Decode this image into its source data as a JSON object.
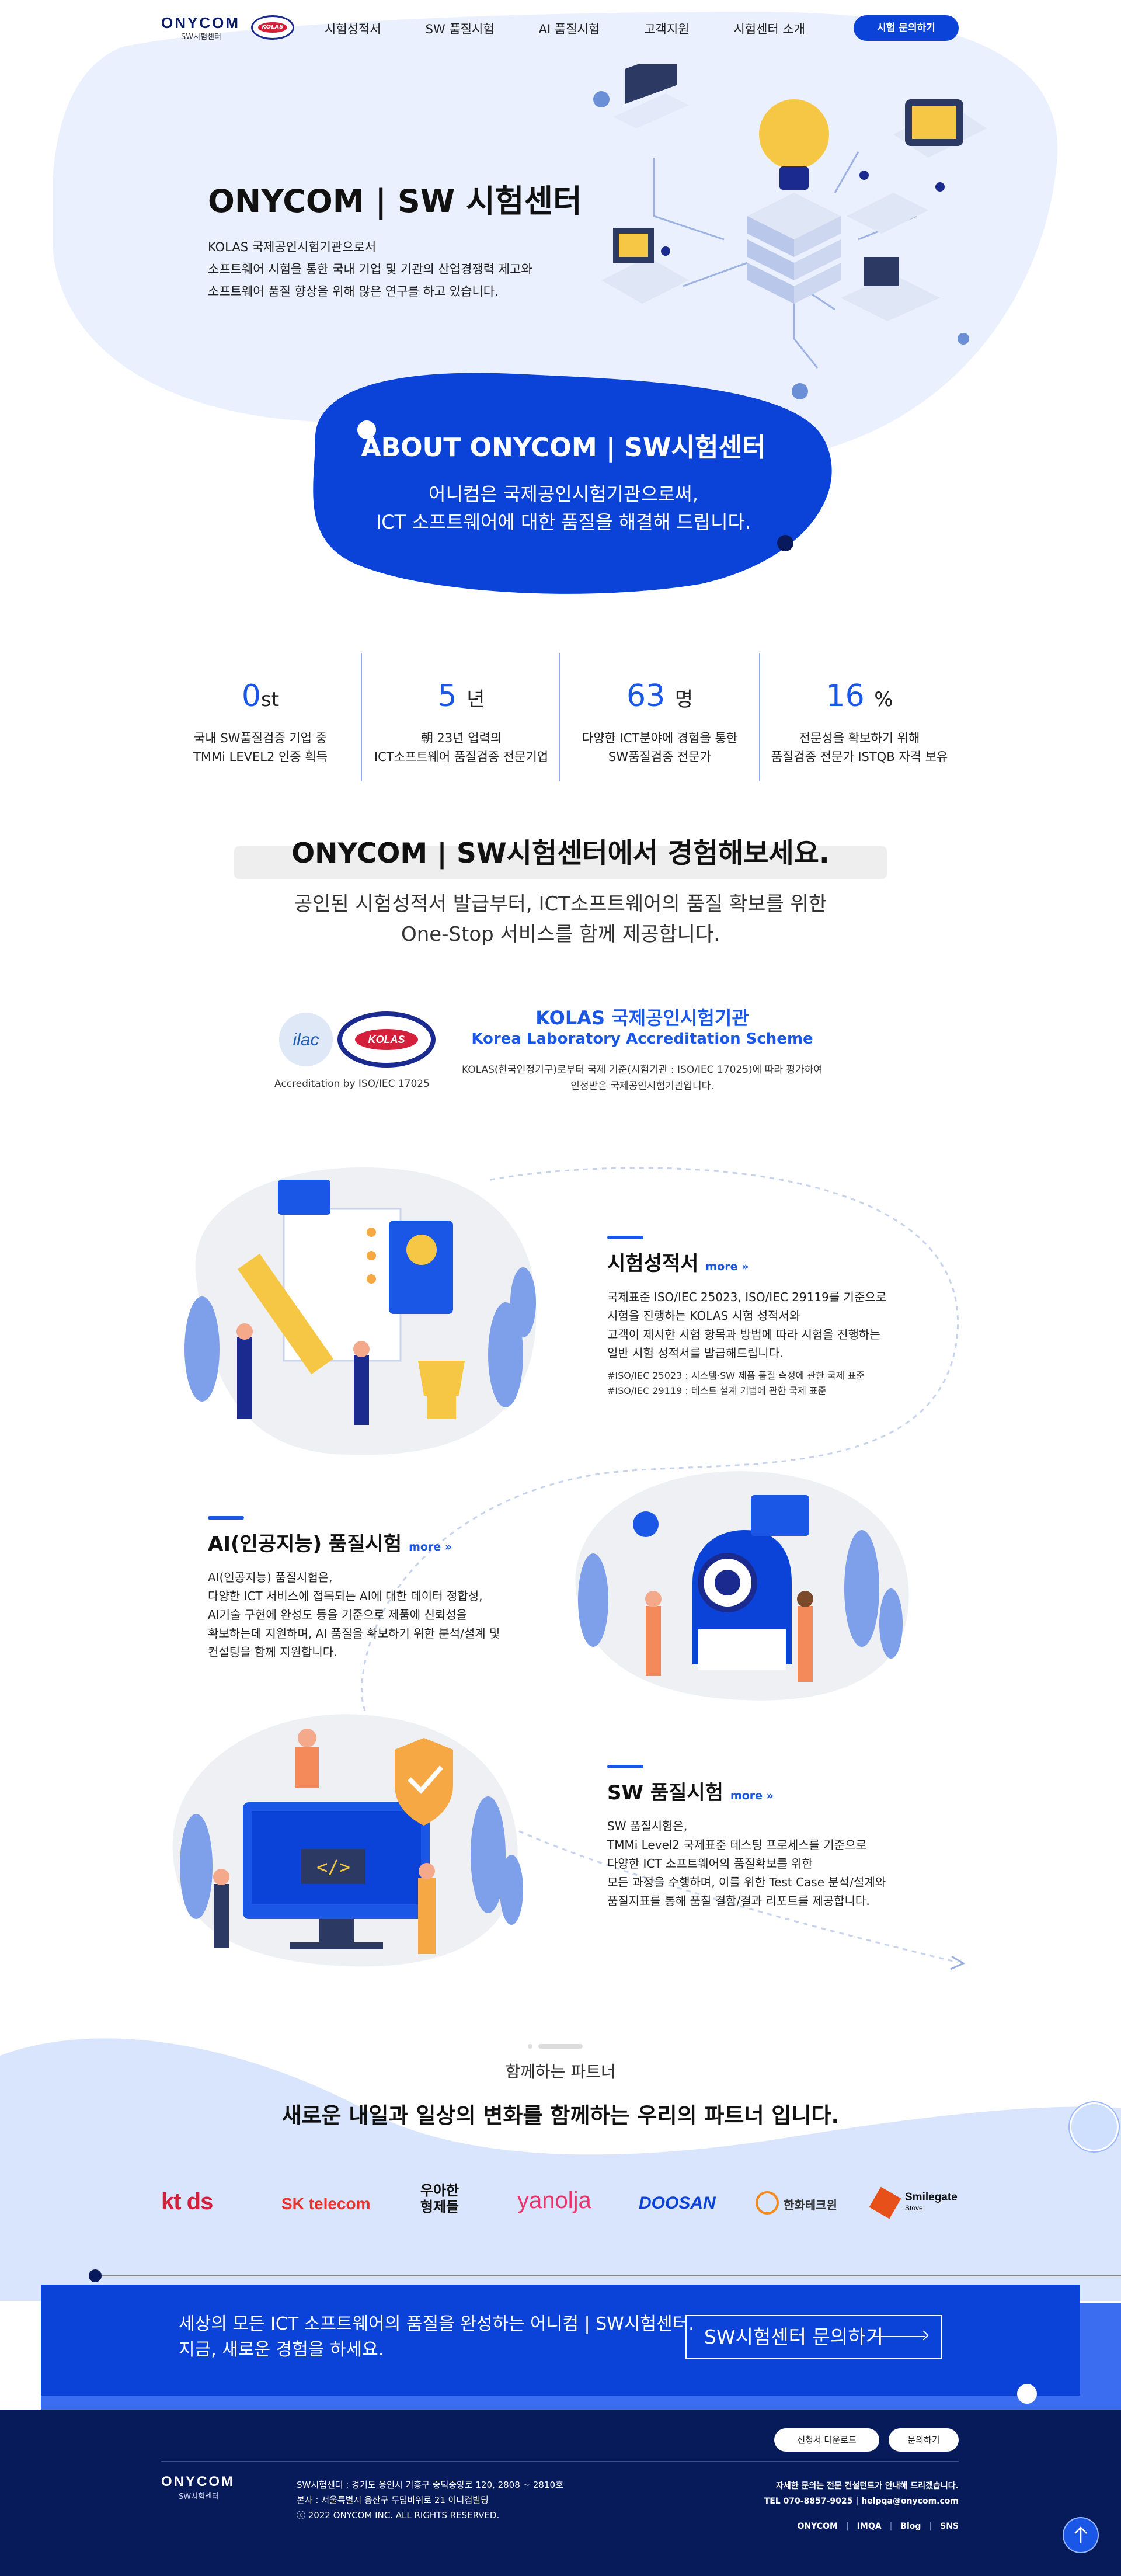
{
  "header": {
    "logo_word": "ONYCOM",
    "logo_sub": "SW시험센터",
    "logo_badge": "KOLAS",
    "nav": [
      "시험성적서",
      "SW 품질시험",
      "AI 품질시험",
      "고객지원",
      "시험센터 소개"
    ],
    "cta": "시험 문의하기"
  },
  "hero": {
    "title": "ONYCOM | SW 시험센터",
    "desc": [
      "KOLAS 국제공인시험기관으로서",
      "소프트웨어 시험을 통한 국내 기업 및 기관의 산업경쟁력 제고와",
      "소프트웨어 품질 향상을 위해 많은 연구를 하고 있습니다."
    ]
  },
  "about": {
    "title": "ABOUT ONYCOM | SW시험센터",
    "desc": [
      "어니컴은 국제공인시험기관으로써,",
      "ICT 소프트웨어에 대한 품질을 해결해 드립니다."
    ]
  },
  "stats": [
    {
      "num": "0",
      "unit": "st",
      "desc": [
        "국내 SW품질검증 기업 중",
        "TMMi LEVEL2 인증 획득"
      ]
    },
    {
      "num": "5",
      "unit": "년",
      "desc": [
        "朝 23년 업력의",
        "ICT소프트웨어 품질검증 전문기업"
      ]
    },
    {
      "num": "63",
      "unit": "명",
      "desc": [
        "다양한 ICT분야에 경험을 통한",
        "SW품질검증 전문가"
      ]
    },
    {
      "num": "16",
      "unit": "%",
      "desc": [
        "전문성을 확보하기 위해",
        "품질검증 전문가 ISTQB 자격 보유"
      ]
    }
  ],
  "experience": {
    "title": "ONYCOM | SW시험센터에서 경험해보세요.",
    "desc": [
      "공인된 시험성적서 발급부터, ICT소프트웨어의 품질 확보를 위한",
      "One-Stop 서비스를 함께 제공합니다."
    ]
  },
  "kolas": {
    "caption": "Accreditation by ISO/IEC 17025",
    "ilac": "ilac",
    "badge": "KOLAS",
    "title": "KOLAS 국제공인시험기관",
    "subtitle": "Korea Laboratory Accreditation Scheme",
    "desc": [
      "KOLAS(한국인정기구)로부터 국제 기준(시험기관 : ISO/IEC 17025)에 따라 평가하여",
      "인정받은 국제공인시험기관입니다."
    ]
  },
  "services": {
    "more": "more »",
    "report": {
      "title": "시험성적서",
      "body": [
        "국제표준 ISO/IEC 25023, ISO/IEC 29119를 기준으로",
        "시험을 진행하는 KOLAS 시험 성적서와",
        "고객이 제시한 시험 항목과 방법에 따라 시험을 진행하는",
        "일반 시험 성적서를 발급해드립니다."
      ],
      "tags": [
        "#ISO/IEC 25023 : 시스템·SW 제품 품질 측정에 관한 국제 표준",
        "#ISO/IEC 29119 : 테스트 설계 기법에 관한 국제 표준"
      ]
    },
    "ai": {
      "title": "AI(인공지능) 품질시험",
      "body": [
        "AI(인공지능) 품질시험은,",
        "다양한 ICT 서비스에 접목되는 AI에 대한 데이터 정합성,",
        "AI기술 구현에 완성도 등을 기준으로 제품에 신뢰성을",
        "확보하는데 지원하며, AI 품질을 확보하기 위한 분석/설계 및",
        "컨설팅을 함께 지원합니다."
      ]
    },
    "sw": {
      "title": "SW 품질시험",
      "body": [
        "SW 품질시험은,",
        "TMMi Level2 국제표준 테스팅 프로세스를 기준으로",
        "다양한 ICT 소프트웨어의 품질확보를 위한",
        "모든 과정을 수행하며, 이를 위한 Test Case 분석/설계와",
        "품질지표를 통해 품질 결함/결과 리포트를 제공합니다."
      ]
    }
  },
  "partners": {
    "label": "함께하는 파트너",
    "title": "새로운 내일과 일상의 변화를 함께하는 우리의 파트너 입니다.",
    "logos": [
      "kt ds",
      "SK telecom",
      "우아한 형제들",
      "yanolja",
      "DOOSAN",
      "한화테크윈",
      "Smilegate",
      "Stove"
    ]
  },
  "cta": {
    "text": [
      "세상의 모든 ICT 소프트웨어의 품질을 완성하는 어니컴 | SW시험센터.",
      "지금, 새로운 경험을 하세요."
    ],
    "button": "SW시험센터 문의하기"
  },
  "footer": {
    "buttons": [
      "신청서 다운로드",
      "문의하기"
    ],
    "logo_word": "ONYCOM",
    "logo_sub": "SW시험센터",
    "address": [
      "SW시험센터 : 경기도 용인시 기흥구 중덕중앙로 120, 2808 ~ 2810호",
      "본사 : 서울특별시 용산구 두텁바위로 21 어니컴빌딩",
      "ⓒ 2022 ONYCOM INC. ALL RIGHTS RESERVED."
    ],
    "contact": [
      "자세한 문의는 전문 컨설턴트가 안내해 드리겠습니다.",
      "TEL 070-8857-9025   |   helpqa@onycom.com"
    ],
    "links": [
      "ONYCOM",
      "IMQA",
      "Blog",
      "SNS"
    ]
  },
  "colors": {
    "primary": "#0b43d8",
    "accent": "#1a57e6",
    "light": "#eaf0fd",
    "footer": "#071a5a"
  }
}
